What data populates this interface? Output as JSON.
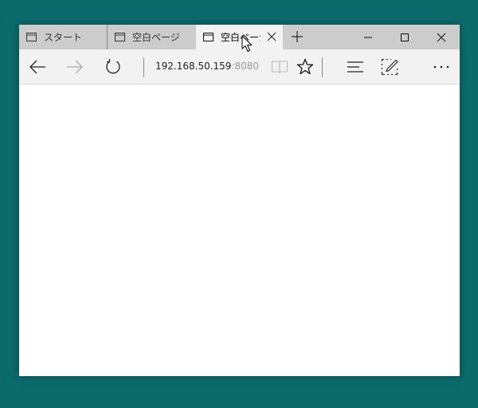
{
  "tabs": [
    {
      "title": "スタート",
      "active": false
    },
    {
      "title": "空白ページ",
      "active": false
    },
    {
      "title": "空白ページ",
      "active": true
    }
  ],
  "toolbar": {
    "address_host": "192.168.50.159",
    "address_port": ":8080"
  },
  "icons": {
    "tab": "page-icon",
    "close": "close-icon",
    "new_tab": "plus-icon",
    "back": "arrow-left-icon",
    "forward": "arrow-right-icon",
    "refresh": "refresh-icon",
    "reading_view": "book-icon",
    "favorite": "star-icon",
    "hub": "hub-icon",
    "web_note": "pen-icon",
    "more": "ellipsis-icon"
  },
  "colors": {
    "desktop": "#0b6b6b",
    "tabbar": "#cccccc",
    "active_tab": "#f2f2f2",
    "toolbar": "#f2f2f2"
  }
}
